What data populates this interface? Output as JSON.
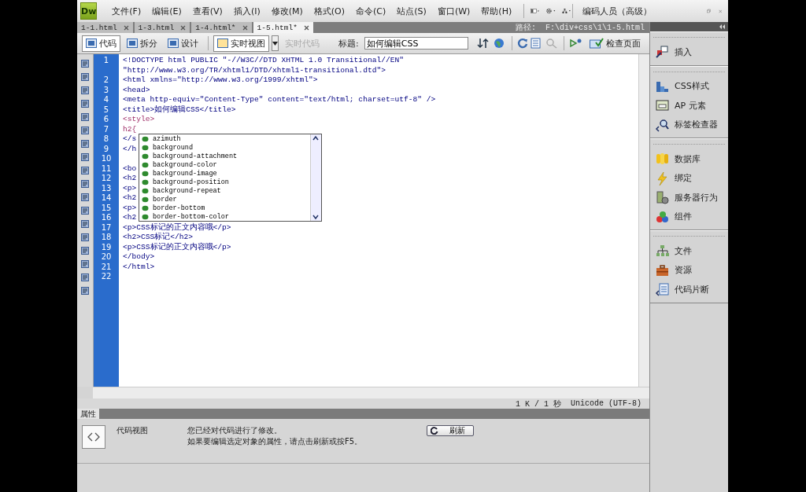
{
  "app": {
    "logo": "Dw",
    "menus": [
      "文件(F)",
      "编辑(E)",
      "查看(V)",
      "插入(I)",
      "修改(M)",
      "格式(O)",
      "命令(C)",
      "站点(S)",
      "窗口(W)",
      "帮助(H)"
    ],
    "workspace": "编码人员（高级）"
  },
  "document_tabs": [
    {
      "label": "1-1.html",
      "selected": false
    },
    {
      "label": "1-3.html",
      "selected": false
    },
    {
      "label": "1-4.html*",
      "selected": false
    },
    {
      "label": "1-5.html*",
      "selected": true
    }
  ],
  "path": {
    "label": "路径:",
    "value": "F:\\div+css\\1\\1-5.html"
  },
  "toolbar": {
    "views": [
      {
        "label": "代码",
        "selected": true
      },
      {
        "label": "拆分",
        "selected": false
      },
      {
        "label": "设计",
        "selected": false
      }
    ],
    "live_view": "实时视图",
    "live_code": {
      "label": "实时代码",
      "disabled": true
    },
    "title_label": "标题:",
    "title_value": "如何编辑CSS",
    "inspect": "检查页面"
  },
  "code_lines": [
    {
      "number": "1",
      "kind": "markup",
      "rows": [
        "<!DOCTYPE html PUBLIC \"-//W3C//DTD XHTML 1.0 Transitional//EN\"",
        "\"http://www.w3.org/TR/xhtml1/DTD/xhtml1-transitional.dtd\">"
      ]
    },
    {
      "number": "2",
      "kind": "markup",
      "rows": [
        "<html xmlns=\"http://www.w3.org/1999/xhtml\">"
      ]
    },
    {
      "number": "3",
      "kind": "markup",
      "rows": [
        "<head>"
      ]
    },
    {
      "number": "4",
      "kind": "markup",
      "rows": [
        "<meta http-equiv=\"Content-Type\" content=\"text/html; charset=utf-8\" />"
      ]
    },
    {
      "number": "5",
      "kind": "markup",
      "rows": [
        "<title>如何编辑CSS</title>"
      ]
    },
    {
      "number": "6",
      "kind": "css",
      "rows": [
        "<style>"
      ]
    },
    {
      "number": "7",
      "kind": "css",
      "rows": [
        "h2{"
      ]
    },
    {
      "number": "8",
      "kind": "markup",
      "rows": [
        "</s"
      ]
    },
    {
      "number": "9",
      "kind": "markup",
      "rows": [
        "</h"
      ]
    },
    {
      "number": "10"
    },
    {
      "number": "11",
      "kind": "markup",
      "rows": [
        "<bo"
      ]
    },
    {
      "number": "12",
      "kind": "markup",
      "rows": [
        "<h2"
      ]
    },
    {
      "number": "13",
      "kind": "markup",
      "rows": [
        "<p>"
      ]
    },
    {
      "number": "14",
      "kind": "markup",
      "rows": [
        "<h2"
      ]
    },
    {
      "number": "15",
      "kind": "markup",
      "rows": [
        "<p>"
      ]
    },
    {
      "number": "16",
      "kind": "markup",
      "rows": [
        "<h2"
      ]
    },
    {
      "number": "17",
      "kind": "markup",
      "rows": [
        "<p>CSS标记的正文内容哦</p>"
      ]
    },
    {
      "number": "18",
      "kind": "markup",
      "rows": [
        "<h2>CSS标记</h2>"
      ]
    },
    {
      "number": "19",
      "kind": "markup",
      "rows": [
        "<p>CSS标记的正文内容哦</p>"
      ]
    },
    {
      "number": "20",
      "kind": "markup",
      "rows": [
        "</body>"
      ]
    },
    {
      "number": "21",
      "kind": "markup",
      "rows": [
        "</html>"
      ]
    },
    {
      "number": "22"
    }
  ],
  "code_hints": [
    "azimuth",
    "background",
    "background-attachment",
    "background-color",
    "background-image",
    "background-position",
    "background-repeat",
    "border",
    "border-bottom",
    "border-bottom-color"
  ],
  "status_bar": {
    "size": "1 K / 1 秒",
    "encoding": "Unicode (UTF-8)"
  },
  "properties": {
    "title": "属性",
    "mode": "代码视图",
    "message": [
      "您已经对代码进行了修改。",
      "如果要编辑选定对象的属性，请点击刷新或按F5。"
    ],
    "refresh": "刷新"
  },
  "panels": [
    [
      {
        "label": "插入"
      }
    ],
    [
      {
        "label": "CSS样式"
      },
      {
        "label": "AP 元素"
      },
      {
        "label": "标签检查器"
      }
    ],
    [
      {
        "label": "数据库"
      },
      {
        "label": "绑定"
      },
      {
        "label": "服务器行为"
      },
      {
        "label": "组件"
      }
    ],
    [
      {
        "label": "文件"
      },
      {
        "label": "资源"
      },
      {
        "label": "代码片断"
      }
    ]
  ]
}
